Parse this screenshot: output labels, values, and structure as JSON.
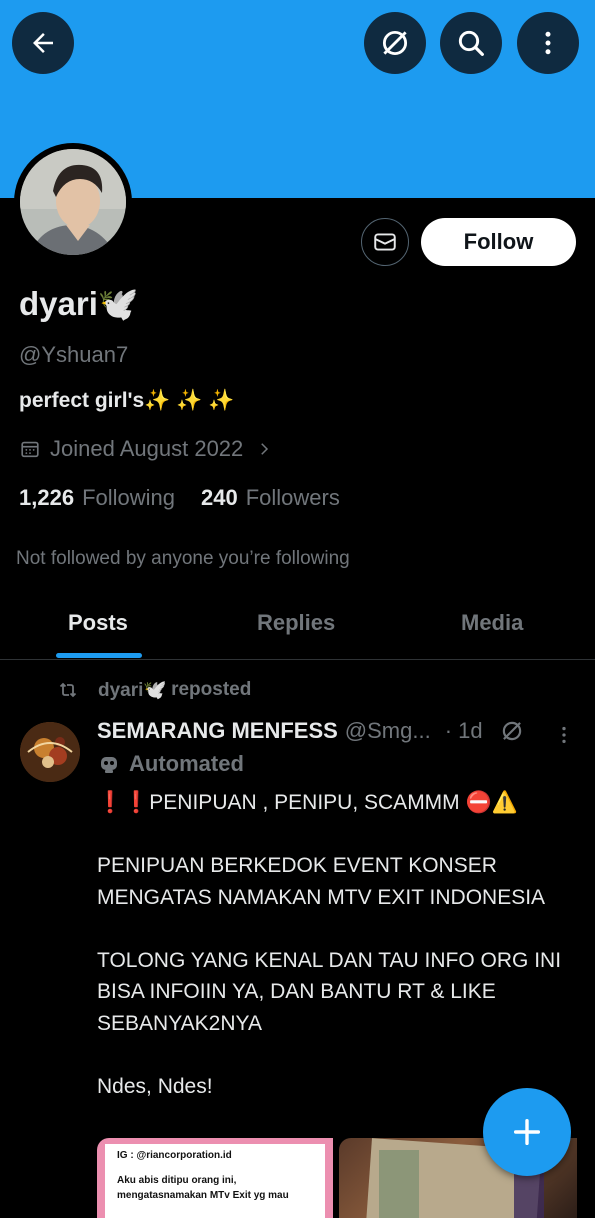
{
  "header": {
    "back_icon": "arrow-left-icon",
    "translate_icon": "slash-circle-icon",
    "search_icon": "search-icon",
    "more_icon": "vertical-dots-icon",
    "banner_color": "#1d9bf0"
  },
  "profile": {
    "name": "dyari🕊️",
    "handle": "@Yshuan7",
    "bio": "perfect girl's✨ ✨ ✨",
    "joined": "Joined August 2022",
    "following_count": "1,226",
    "following_label": "Following",
    "followers_count": "240",
    "followers_label": "Followers",
    "not_followed_text": "Not followed by anyone you’re following",
    "follow_label": "Follow"
  },
  "tabs": [
    {
      "label": "Posts",
      "active": true
    },
    {
      "label": "Replies",
      "active": false
    },
    {
      "label": "Media",
      "active": false
    }
  ],
  "post": {
    "repost_by": "dyari🕊️",
    "repost_label": "reposted",
    "author_name": "SEMARANG MENFESS",
    "author_handle": "@Smg...",
    "time": "· 1d",
    "automated_label": "Automated",
    "lines": [
      "❗❗PENIPUAN , PENIPU, SCAMMM ⛔⚠️",
      "PENIPUAN BERKEDOK EVENT KONSER MENGATAS NAMAKAN MTV EXIT INDONESIA",
      "TOLONG YANG KENAL DAN TAU INFO ORG INI BISA INFOIIN YA, DAN BANTU RT & LIKE SEBANYAK2NYA",
      "Ndes, Ndes!"
    ],
    "media_1_line1": "IG : @riancorporation.id",
    "media_1_line2": "Aku abis ditipu orang ini,",
    "media_1_line3": "mengatasnamakan MTv Exit yg mau"
  },
  "fab": {
    "icon": "plus-icon"
  }
}
